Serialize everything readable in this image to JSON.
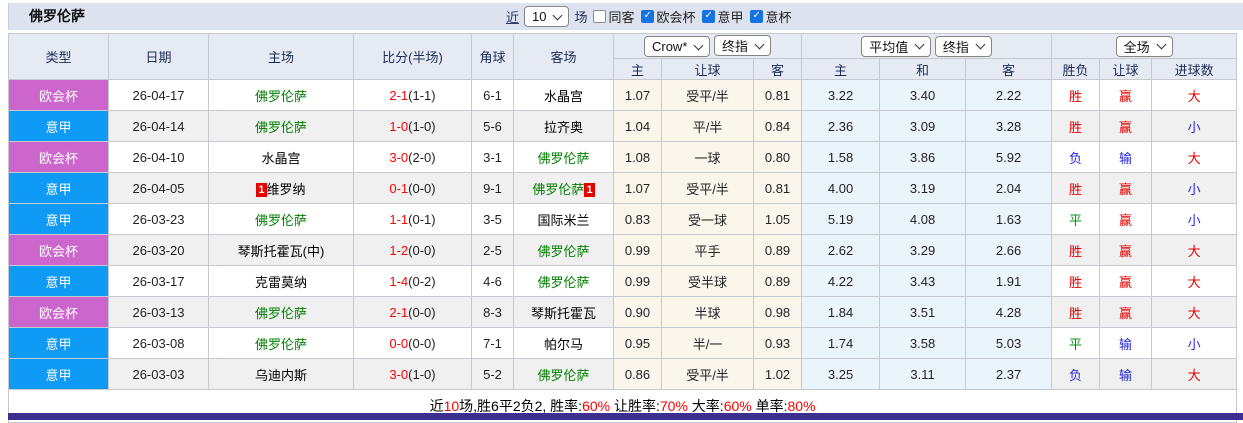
{
  "page": {
    "title": "佛罗伦萨",
    "toolbar": {
      "near_label": "近",
      "count_select": "10",
      "games_label": "场",
      "filters": [
        {
          "label": "同客",
          "checked": false
        },
        {
          "label": "欧会杯",
          "checked": true
        },
        {
          "label": "意甲",
          "checked": true
        },
        {
          "label": "意杯",
          "checked": true
        }
      ]
    }
  },
  "table": {
    "left_headers": [
      "类型",
      "日期",
      "主场",
      "比分(半场)",
      "角球",
      "客场"
    ],
    "group_headers": {
      "asian": {
        "selects": [
          "Crow*",
          "终指"
        ]
      },
      "euro": {
        "selects": [
          "平均值",
          "终指"
        ]
      },
      "result": {
        "selects": [
          "全场"
        ]
      }
    },
    "sub_headers": [
      "主",
      "让球",
      "客",
      "主",
      "和",
      "客",
      "胜负",
      "让球",
      "进球数"
    ],
    "red_card_text": "1",
    "rows": [
      {
        "league": "欧会杯",
        "date": "26-04-17",
        "home": "佛罗伦萨",
        "home_green": true,
        "home_red": false,
        "score": "2-1",
        "half": "(1-1)",
        "corner": "6-1",
        "away": "水晶宫",
        "away_green": false,
        "away_red": false,
        "asian": [
          "1.07",
          "受平/半",
          "0.81"
        ],
        "euro": [
          "3.22",
          "3.40",
          "2.22"
        ],
        "results": [
          {
            "text": "胜",
            "color": "red"
          },
          {
            "text": "赢",
            "color": "red"
          },
          {
            "text": "大",
            "color": "red"
          }
        ]
      },
      {
        "league": "意甲",
        "date": "26-04-14",
        "home": "佛罗伦萨",
        "home_green": true,
        "home_red": false,
        "score": "1-0",
        "half": "(1-0)",
        "corner": "5-6",
        "away": "拉齐奥",
        "away_green": false,
        "away_red": false,
        "asian": [
          "1.04",
          "平/半",
          "0.84"
        ],
        "euro": [
          "2.36",
          "3.09",
          "3.28"
        ],
        "results": [
          {
            "text": "胜",
            "color": "red"
          },
          {
            "text": "赢",
            "color": "red"
          },
          {
            "text": "小",
            "color": "blue"
          }
        ]
      },
      {
        "league": "欧会杯",
        "date": "26-04-10",
        "home": "水晶宫",
        "home_green": false,
        "home_red": false,
        "score": "3-0",
        "half": "(2-0)",
        "corner": "3-1",
        "away": "佛罗伦萨",
        "away_green": true,
        "away_red": false,
        "asian": [
          "1.08",
          "一球",
          "0.80"
        ],
        "euro": [
          "1.58",
          "3.86",
          "5.92"
        ],
        "results": [
          {
            "text": "负",
            "color": "blue"
          },
          {
            "text": "输",
            "color": "blue"
          },
          {
            "text": "大",
            "color": "red"
          }
        ]
      },
      {
        "league": "意甲",
        "date": "26-04-05",
        "home": "维罗纳",
        "home_green": false,
        "home_red": true,
        "score": "0-1",
        "half": "(0-0)",
        "corner": "9-1",
        "away": "佛罗伦萨",
        "away_green": true,
        "away_red": true,
        "asian": [
          "1.07",
          "受平/半",
          "0.81"
        ],
        "euro": [
          "4.00",
          "3.19",
          "2.04"
        ],
        "results": [
          {
            "text": "胜",
            "color": "red"
          },
          {
            "text": "赢",
            "color": "red"
          },
          {
            "text": "小",
            "color": "blue"
          }
        ]
      },
      {
        "league": "意甲",
        "date": "26-03-23",
        "home": "佛罗伦萨",
        "home_green": true,
        "home_red": false,
        "score": "1-1",
        "half": "(0-1)",
        "corner": "3-5",
        "away": "国际米兰",
        "away_green": false,
        "away_red": false,
        "asian": [
          "0.83",
          "受一球",
          "1.05"
        ],
        "euro": [
          "5.19",
          "4.08",
          "1.63"
        ],
        "results": [
          {
            "text": "平",
            "color": "green"
          },
          {
            "text": "赢",
            "color": "red"
          },
          {
            "text": "小",
            "color": "blue"
          }
        ]
      },
      {
        "league": "欧会杯",
        "date": "26-03-20",
        "home": "琴斯托霍瓦(中)",
        "home_green": false,
        "home_red": false,
        "score": "1-2",
        "half": "(0-0)",
        "corner": "2-5",
        "away": "佛罗伦萨",
        "away_green": true,
        "away_red": false,
        "asian": [
          "0.99",
          "平手",
          "0.89"
        ],
        "euro": [
          "2.62",
          "3.29",
          "2.66"
        ],
        "results": [
          {
            "text": "胜",
            "color": "red"
          },
          {
            "text": "赢",
            "color": "red"
          },
          {
            "text": "大",
            "color": "red"
          }
        ]
      },
      {
        "league": "意甲",
        "date": "26-03-17",
        "home": "克雷莫纳",
        "home_green": false,
        "home_red": false,
        "score": "1-4",
        "half": "(0-2)",
        "corner": "4-6",
        "away": "佛罗伦萨",
        "away_green": true,
        "away_red": false,
        "asian": [
          "0.99",
          "受半球",
          "0.89"
        ],
        "euro": [
          "4.22",
          "3.43",
          "1.91"
        ],
        "results": [
          {
            "text": "胜",
            "color": "red"
          },
          {
            "text": "赢",
            "color": "red"
          },
          {
            "text": "大",
            "color": "red"
          }
        ]
      },
      {
        "league": "欧会杯",
        "date": "26-03-13",
        "home": "佛罗伦萨",
        "home_green": true,
        "home_red": false,
        "score": "2-1",
        "half": "(0-0)",
        "corner": "8-3",
        "away": "琴斯托霍瓦",
        "away_green": false,
        "away_red": false,
        "asian": [
          "0.90",
          "半球",
          "0.98"
        ],
        "euro": [
          "1.84",
          "3.51",
          "4.28"
        ],
        "results": [
          {
            "text": "胜",
            "color": "red"
          },
          {
            "text": "赢",
            "color": "red"
          },
          {
            "text": "大",
            "color": "red"
          }
        ]
      },
      {
        "league": "意甲",
        "date": "26-03-08",
        "home": "佛罗伦萨",
        "home_green": true,
        "home_red": false,
        "score": "0-0",
        "half": "(0-0)",
        "corner": "7-1",
        "away": "帕尔马",
        "away_green": false,
        "away_red": false,
        "asian": [
          "0.95",
          "半/一",
          "0.93"
        ],
        "euro": [
          "1.74",
          "3.58",
          "5.03"
        ],
        "results": [
          {
            "text": "平",
            "color": "green"
          },
          {
            "text": "输",
            "color": "blue"
          },
          {
            "text": "小",
            "color": "blue"
          }
        ]
      },
      {
        "league": "意甲",
        "date": "26-03-03",
        "home": "乌迪内斯",
        "home_green": false,
        "home_red": false,
        "score": "3-0",
        "half": "(1-0)",
        "corner": "5-2",
        "away": "佛罗伦萨",
        "away_green": true,
        "away_red": false,
        "asian": [
          "0.86",
          "受平/半",
          "1.02"
        ],
        "euro": [
          "3.25",
          "3.11",
          "2.37"
        ],
        "results": [
          {
            "text": "负",
            "color": "blue"
          },
          {
            "text": "输",
            "color": "blue"
          },
          {
            "text": "大",
            "color": "red"
          }
        ]
      }
    ],
    "footer": [
      {
        "text": "近",
        "color": "dark"
      },
      {
        "text": "10",
        "color": "red"
      },
      {
        "text": "场,胜6平2负2, 胜率:",
        "color": "dark"
      },
      {
        "text": "60%",
        "color": "red"
      },
      {
        "text": " 让胜率:",
        "color": "dark"
      },
      {
        "text": "70%",
        "color": "red"
      },
      {
        "text": " 大率:",
        "color": "dark"
      },
      {
        "text": "60%",
        "color": "red"
      },
      {
        "text": " 单率:",
        "color": "dark"
      },
      {
        "text": "80%",
        "color": "red"
      }
    ]
  },
  "colors": {
    "league": {
      "欧会杯": "#cc66cc",
      "意甲": "#0f9af5"
    },
    "result_red": "#e60000",
    "result_blue": "#2727d8",
    "result_green": "#089010",
    "score_red": "#ff0000",
    "fav_team_green": "#008000",
    "asian_odds_bg": "#fbf6ec",
    "euro_odds_bg": "#eaf4fb",
    "stripe_bg": "#f0f0f0",
    "topbar_bg": "#dce3ef",
    "header_bg": "#e5eaf3",
    "bottom_bar": "#3c2f8f",
    "checkbox_blue": "#1673e6",
    "red_card_bg": "#e80000"
  }
}
